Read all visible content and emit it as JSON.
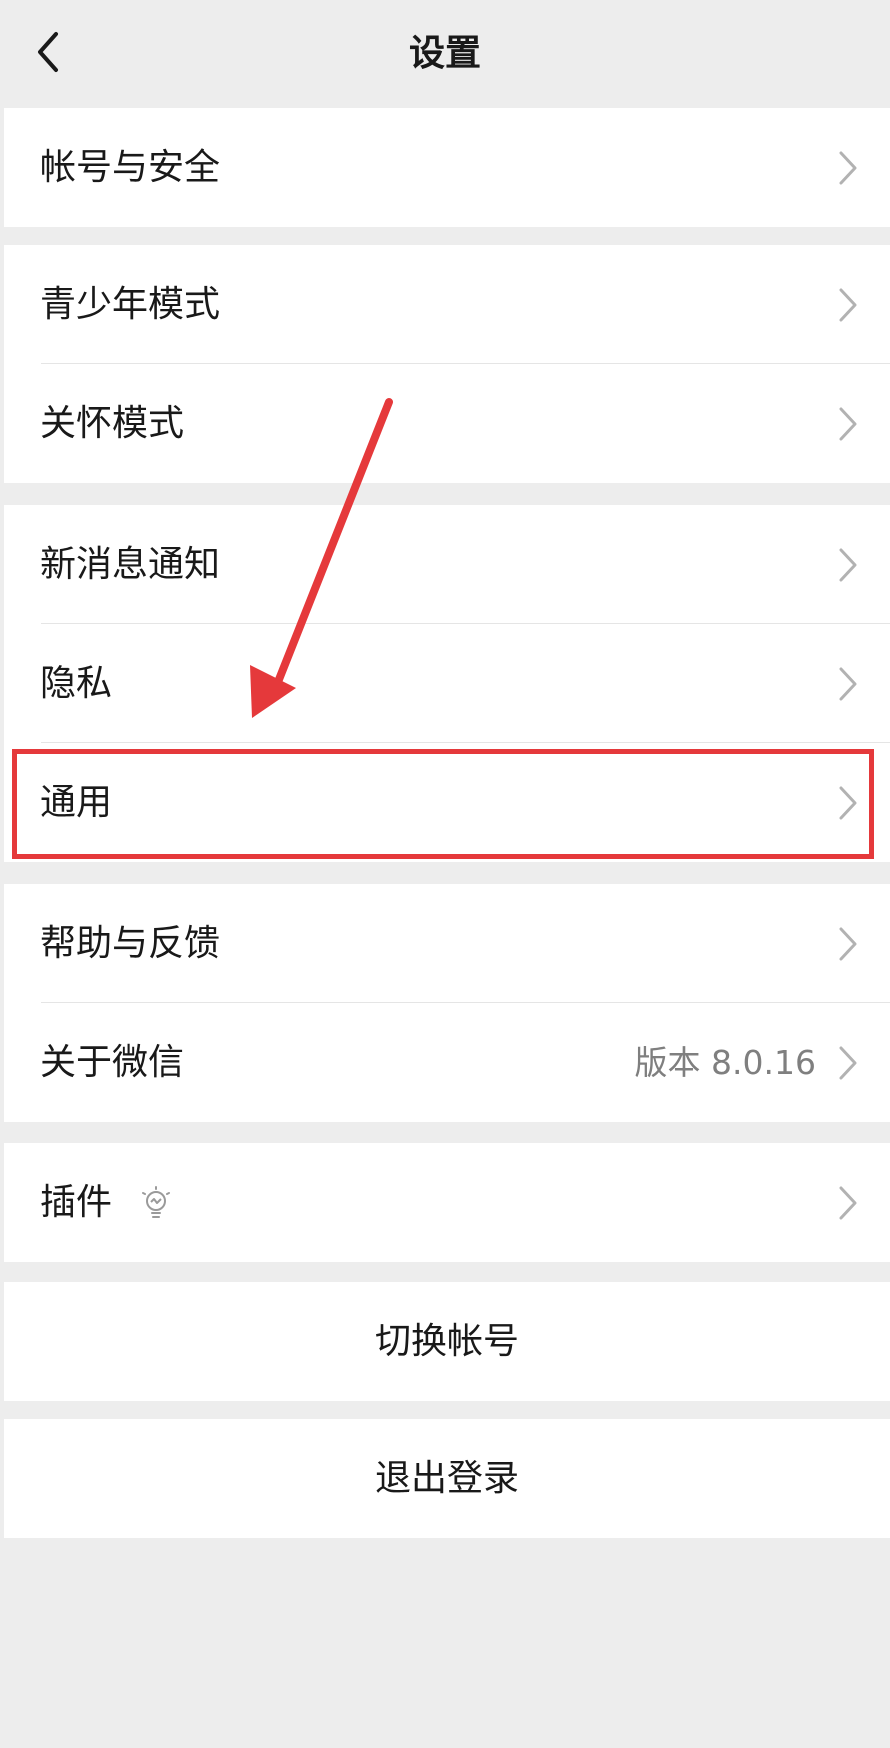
{
  "header": {
    "title": "设置",
    "back_icon": "chevron-left-icon"
  },
  "groups": [
    {
      "items": [
        {
          "label": "帐号与安全"
        }
      ]
    },
    {
      "items": [
        {
          "label": "青少年模式"
        },
        {
          "label": "关怀模式"
        }
      ]
    },
    {
      "items": [
        {
          "label": "新消息通知"
        },
        {
          "label": "隐私"
        },
        {
          "label": "通用"
        }
      ]
    },
    {
      "items": [
        {
          "label": "帮助与反馈"
        },
        {
          "label": "关于微信",
          "value": "版本 8.0.16"
        }
      ]
    },
    {
      "items": [
        {
          "label": "插件",
          "icon": "lightbulb-icon"
        }
      ]
    }
  ],
  "actions": {
    "switch_account": "切换帐号",
    "logout": "退出登录"
  },
  "colors": {
    "background": "#ededed",
    "row_background": "#ffffff",
    "text": "#191919",
    "secondary_text": "#7f7f7f",
    "chevron": "#b2b2b2",
    "annotation": "#e5393b"
  },
  "annotation": {
    "highlighted_item": "通用",
    "arrow_icon": "red-arrow-icon"
  }
}
